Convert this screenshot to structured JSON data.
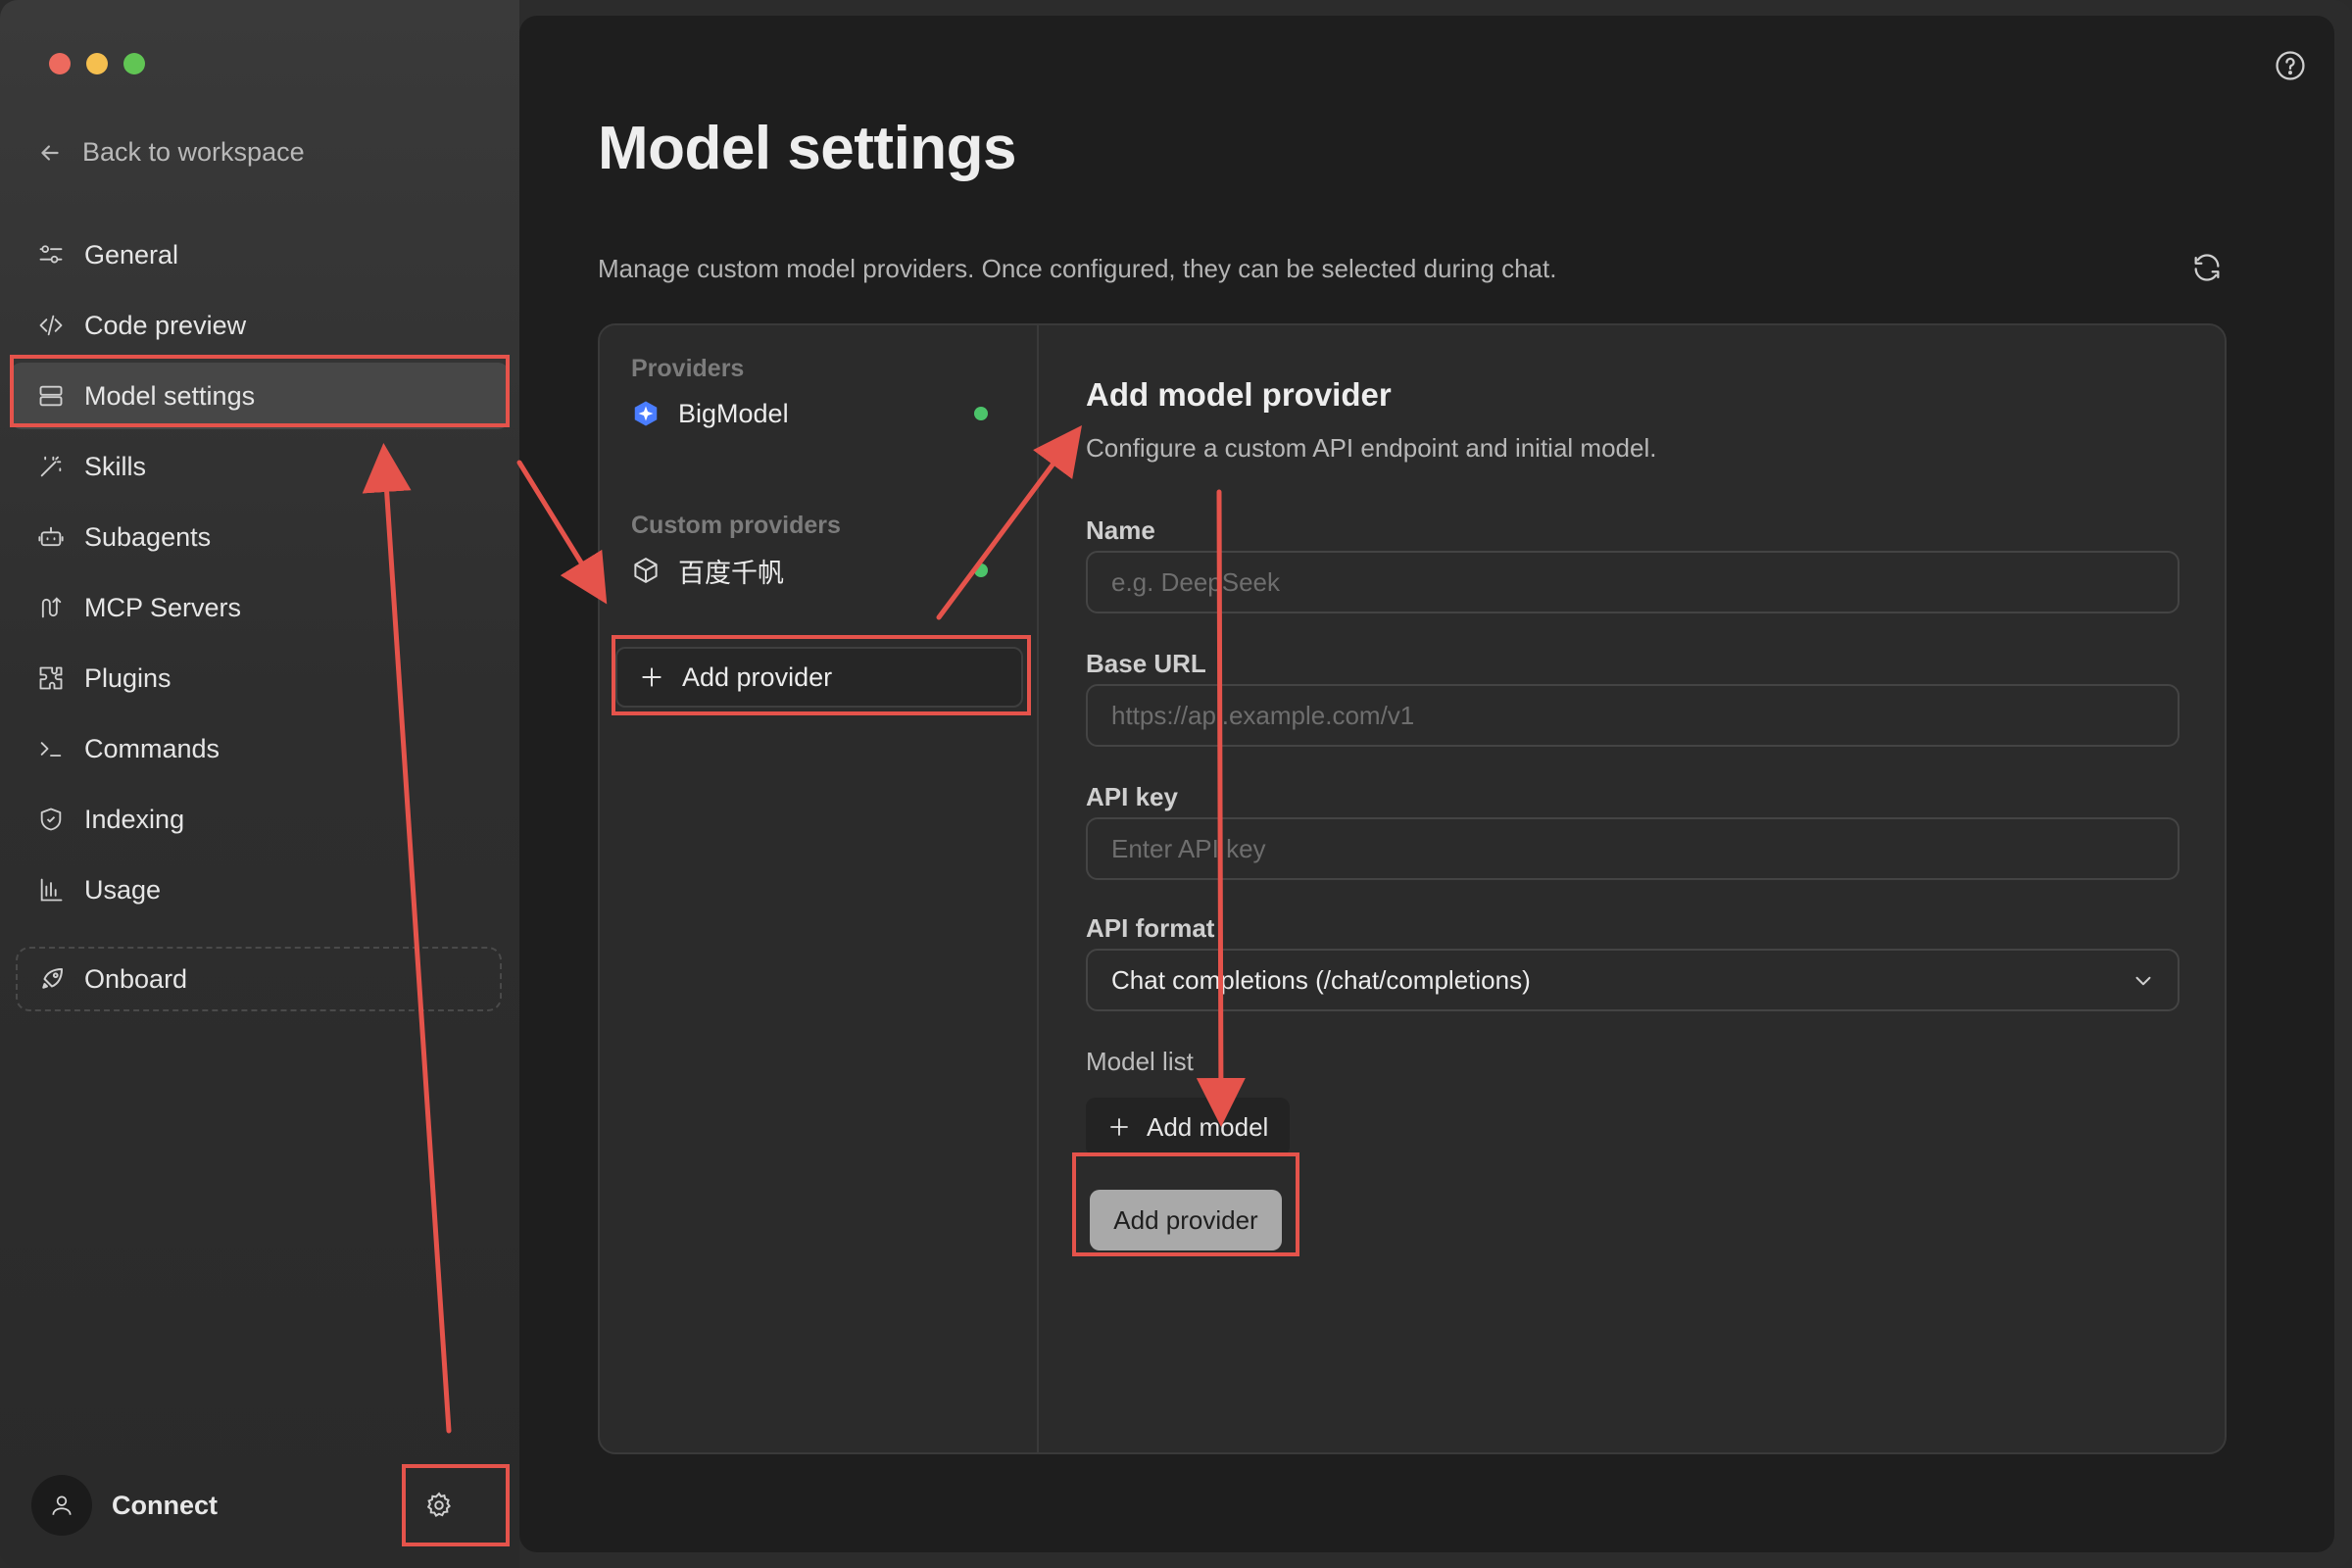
{
  "window": {
    "traffic_lights": [
      "close",
      "minimize",
      "maximize"
    ]
  },
  "sidebar": {
    "back_label": "Back to workspace",
    "items": [
      {
        "label": "General",
        "icon": "sliders-icon"
      },
      {
        "label": "Code preview",
        "icon": "code-icon"
      },
      {
        "label": "Model settings",
        "icon": "server-icon",
        "active": true
      },
      {
        "label": "Skills",
        "icon": "magic-wand-icon"
      },
      {
        "label": "Subagents",
        "icon": "robot-icon"
      },
      {
        "label": "MCP Servers",
        "icon": "mcp-icon"
      },
      {
        "label": "Plugins",
        "icon": "puzzle-icon"
      },
      {
        "label": "Commands",
        "icon": "terminal-icon"
      },
      {
        "label": "Indexing",
        "icon": "shield-icon"
      },
      {
        "label": "Usage",
        "icon": "bar-chart-icon"
      }
    ],
    "onboard_label": "Onboard",
    "connect_label": "Connect"
  },
  "main": {
    "title": "Model settings",
    "subtitle": "Manage custom model providers. Once configured, they can be selected during chat.",
    "providers": {
      "section_label": "Providers",
      "items": [
        {
          "name": "BigModel",
          "status": "active"
        }
      ],
      "custom_section_label": "Custom providers",
      "custom_items": [
        {
          "name": "百度千帆",
          "status": "active"
        }
      ],
      "add_label": "Add provider"
    },
    "form": {
      "title": "Add model provider",
      "description": "Configure a custom API endpoint and initial model.",
      "name_label": "Name",
      "name_placeholder": "e.g. DeepSeek",
      "base_url_label": "Base URL",
      "base_url_placeholder": "https://api.example.com/v1",
      "api_key_label": "API key",
      "api_key_placeholder": "Enter API key",
      "api_format_label": "API format",
      "api_format_value": "Chat completions (/chat/completions)",
      "model_list_label": "Model list",
      "add_model_label": "Add model",
      "submit_label": "Add provider"
    }
  },
  "colors": {
    "annotation": "#e5534b",
    "status_dot": "#4cc46a",
    "accent_icon": "#4a7dff"
  }
}
